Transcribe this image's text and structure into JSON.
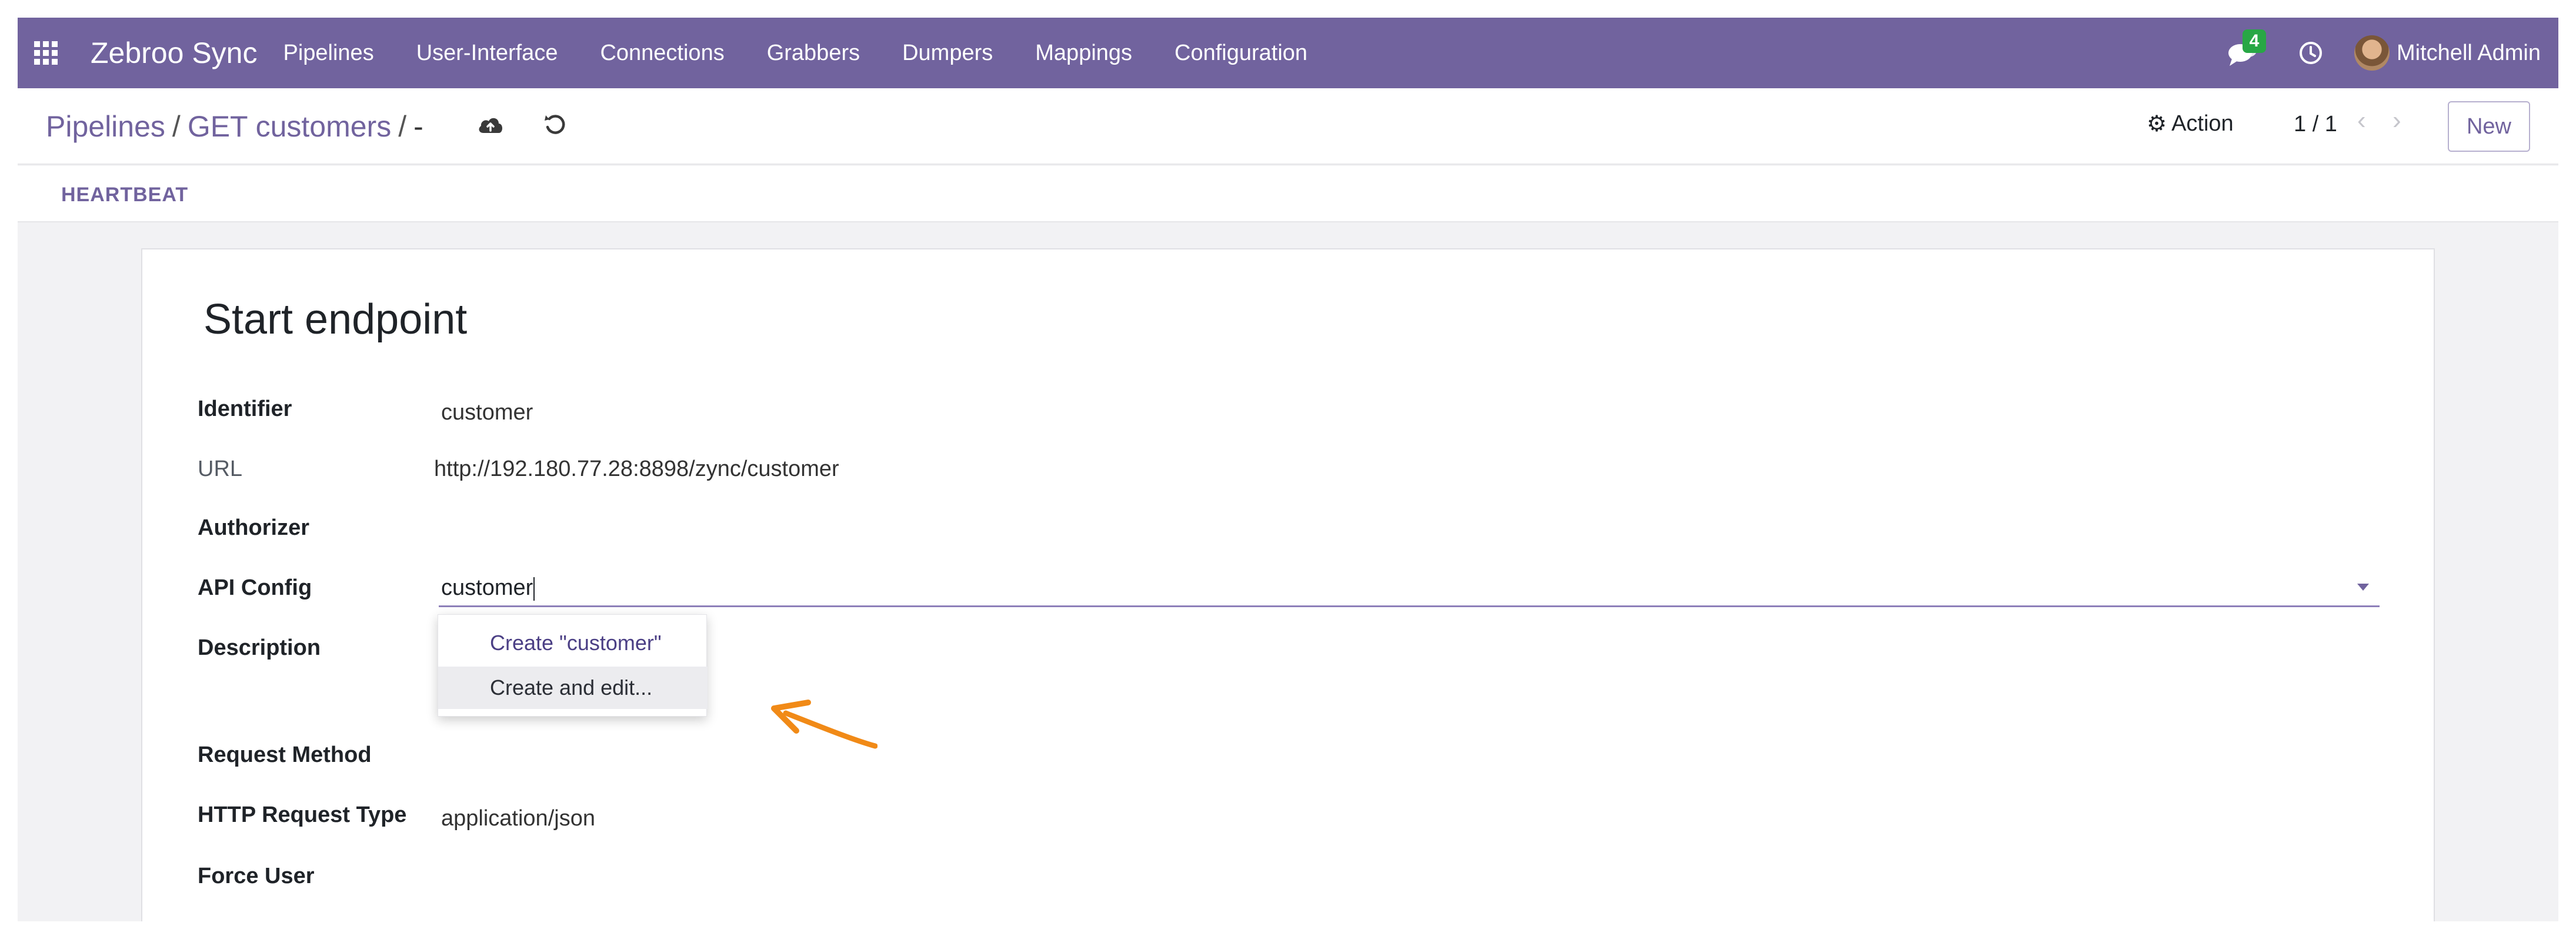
{
  "navbar": {
    "brand": "Zebroo Sync",
    "menu": [
      "Pipelines",
      "User-Interface",
      "Connections",
      "Grabbers",
      "Dumpers",
      "Mappings",
      "Configuration"
    ],
    "chat_badge": "4",
    "user_name": "Mitchell Admin",
    "accent_color": "#71639e"
  },
  "control": {
    "breadcrumb": {
      "root": "Pipelines",
      "sep": "/",
      "parent": "GET customers",
      "current": "-"
    },
    "action_label": "Action",
    "pager": "1 / 1",
    "new_label": "New"
  },
  "statusbar": {
    "heartbeat_label": "HEARTBEAT"
  },
  "form": {
    "title": "Start endpoint",
    "fields": {
      "identifier": {
        "label": "Identifier",
        "value": "customer"
      },
      "url": {
        "label": "URL",
        "value": "http://192.180.77.28:8898/zync/customer"
      },
      "authorizer": {
        "label": "Authorizer",
        "value": ""
      },
      "api_config": {
        "label": "API Config",
        "value": "customer"
      },
      "description": {
        "label": "Description",
        "value": ""
      },
      "request_method": {
        "label": "Request Method",
        "value": ""
      },
      "http_request_type": {
        "label": "HTTP Request Type",
        "value": "application/json"
      },
      "force_user": {
        "label": "Force User",
        "value": ""
      }
    },
    "dropdown": {
      "create": "Create \"customer\"",
      "create_edit": "Create and edit..."
    }
  },
  "icons": {
    "apps": "apps-grid-icon",
    "chat": "chat-icon",
    "clock": "clock-icon",
    "save": "cloud-upload-icon",
    "discard": "undo-icon",
    "gear": "gear-icon",
    "annotation": "orange-arrow-icon"
  }
}
